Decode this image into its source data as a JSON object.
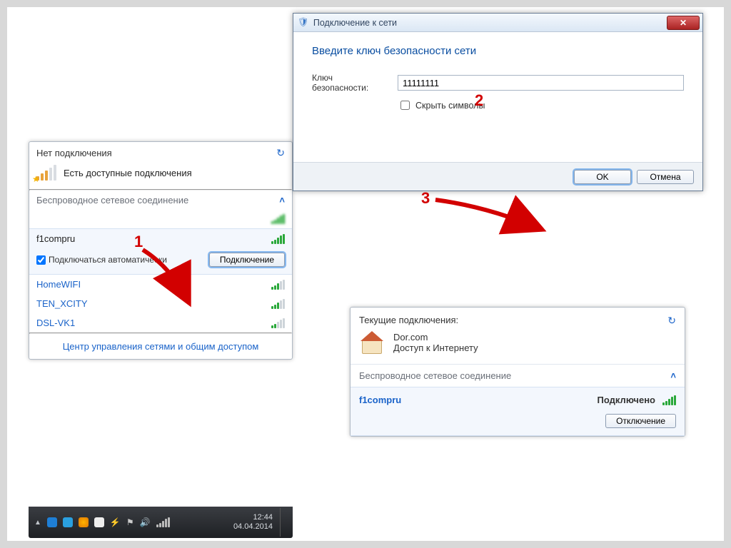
{
  "annotations": {
    "step1": "1",
    "step2": "2",
    "step3": "3"
  },
  "flyout1": {
    "header": "Нет подключения",
    "status": "Есть доступные подключения",
    "section": "Беспроводное сетевое соединение",
    "footer_link": "Центр управления сетями и общим доступом",
    "auto_connect": "Подключаться автоматически",
    "connect_btn": "Подключение",
    "networks": [
      {
        "name": "",
        "signal": "s5",
        "blurred": true
      },
      {
        "name": "f1compru",
        "signal": "s5",
        "selected": true
      },
      {
        "name": "HomeWIFI",
        "signal": "s3"
      },
      {
        "name": "TEN_XCITY",
        "signal": "s3"
      },
      {
        "name": "DSL-VK1",
        "signal": "s2"
      }
    ]
  },
  "taskbar": {
    "time": "12:44",
    "date": "04.04.2014"
  },
  "dialog": {
    "title": "Подключение к сети",
    "heading": "Введите ключ безопасности сети",
    "key_label": "Ключ безопасности:",
    "key_value": "11111111",
    "hide_chars": "Скрыть символы",
    "ok": "OK",
    "cancel": "Отмена"
  },
  "flyout2": {
    "header": "Текущие подключения:",
    "conn_name": "Dor.com",
    "conn_status": "Доступ к Интернету",
    "section": "Беспроводное сетевое соединение",
    "net_name": "f1compru",
    "net_state": "Подключено",
    "disconnect": "Отключение"
  }
}
